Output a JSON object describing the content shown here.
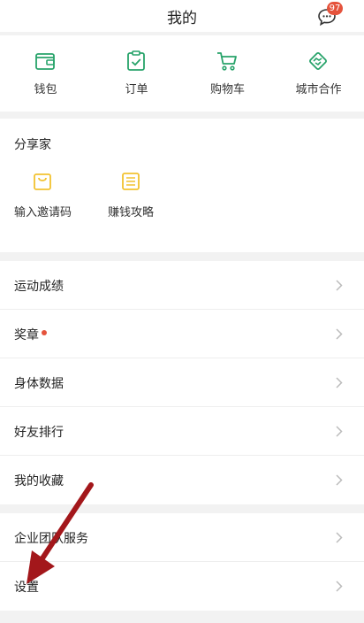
{
  "header": {
    "title": "我的",
    "message_badge": "97"
  },
  "quick_actions": [
    {
      "label": "钱包",
      "icon": "wallet-icon"
    },
    {
      "label": "订单",
      "icon": "order-icon"
    },
    {
      "label": "购物车",
      "icon": "cart-icon"
    },
    {
      "label": "城市合作",
      "icon": "handshake-icon"
    }
  ],
  "share_section": {
    "title": "分享家",
    "items": [
      {
        "label": "输入邀请码",
        "icon": "bag-icon"
      },
      {
        "label": "赚钱攻略",
        "icon": "list-icon"
      }
    ]
  },
  "menu": [
    {
      "label": "运动成绩"
    },
    {
      "label": "奖章"
    },
    {
      "label": "身体数据"
    },
    {
      "label": "好友排行"
    },
    {
      "label": "我的收藏"
    }
  ],
  "menu2": [
    {
      "label": "企业团队服务"
    },
    {
      "label": "设置"
    }
  ],
  "colors": {
    "accent": "#27a36a",
    "share_icon": "#f2c230",
    "badge": "#e5533c",
    "annotation_arrow": "#a3171b"
  }
}
